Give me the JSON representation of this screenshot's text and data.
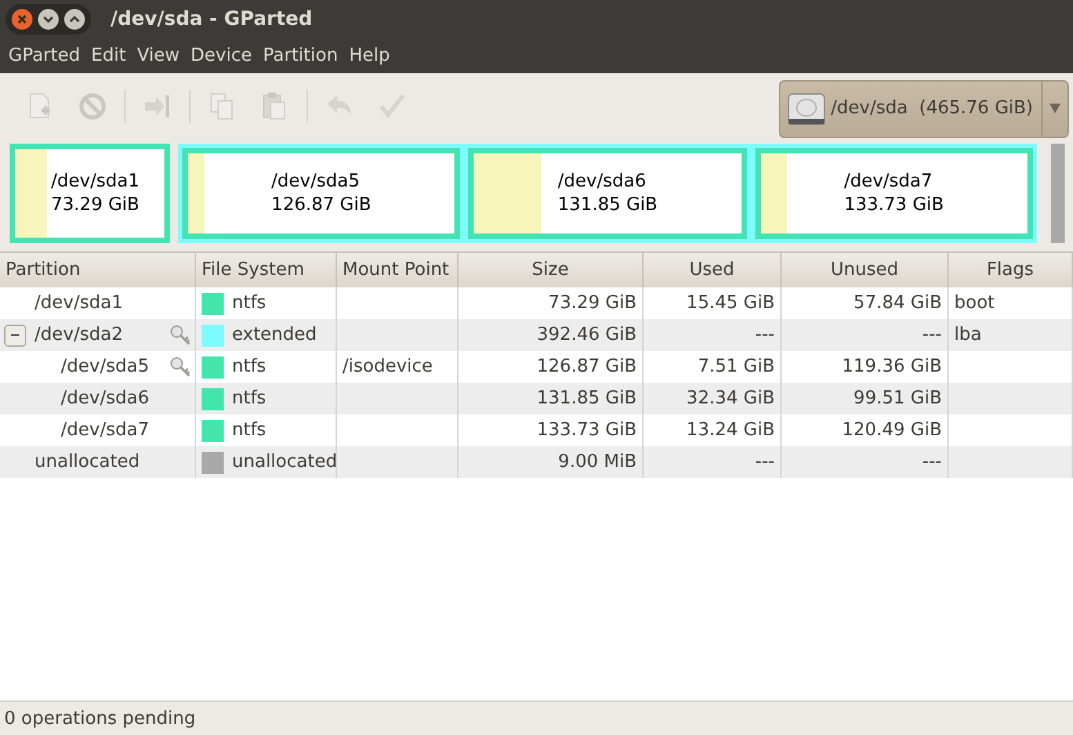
{
  "window": {
    "title": "/dev/sda - GParted",
    "controls": [
      {
        "kind": "close"
      },
      {
        "kind": "minimize"
      },
      {
        "kind": "maximize"
      }
    ]
  },
  "menu": [
    "GParted",
    "Edit",
    "View",
    "Device",
    "Partition",
    "Help"
  ],
  "toolbar": {
    "buttons": [
      {
        "kind": "new",
        "disabled": true
      },
      {
        "kind": "delete",
        "disabled": true
      },
      {
        "kind": "resize",
        "disabled": true
      },
      {
        "kind": "copy",
        "disabled": true
      },
      {
        "kind": "paste",
        "disabled": true
      },
      {
        "kind": "undo",
        "disabled": true
      },
      {
        "kind": "apply",
        "disabled": true
      }
    ],
    "device": {
      "label": "/dev/sda  (465.76 GiB)"
    }
  },
  "disk_map": {
    "blocks": [
      {
        "kind": "primary",
        "name": "/dev/sda1",
        "size": "73.29 GiB",
        "level": 0.21
      },
      {
        "kind": "extended",
        "children": [
          {
            "name": "/dev/sda5",
            "size": "126.87 GiB",
            "level": 0.06
          },
          {
            "name": "/dev/sda6",
            "size": "131.85 GiB",
            "level": 0.25
          },
          {
            "name": "/dev/sda7",
            "size": "133.73 GiB",
            "level": 0.1
          }
        ]
      },
      {
        "kind": "unallocated"
      }
    ]
  },
  "table": {
    "columns": [
      "Partition",
      "File System",
      "Mount Point",
      "Size",
      "Used",
      "Unused",
      "Flags"
    ],
    "rows": [
      {
        "partition": "/dev/sda1",
        "busy": false,
        "filesystem": "ntfs",
        "color": "#42e5ac",
        "size": "73.29 GiB",
        "used": "15.45 GiB",
        "unused": "57.84 GiB",
        "flags": "boot"
      },
      {
        "partition": "/dev/sda2",
        "busy": true,
        "expanded": true,
        "filesystem": "extended",
        "color": "#7dfcfe",
        "size": "392.46 GiB",
        "used": "---",
        "unused": "---",
        "flags": "lba",
        "children": [
          {
            "partition": "/dev/sda5",
            "busy": true,
            "filesystem": "ntfs",
            "color": "#42e5ac",
            "mount": "/isodevice",
            "size": "126.87 GiB",
            "used": "7.51 GiB",
            "unused": "119.36 GiB"
          },
          {
            "partition": "/dev/sda6",
            "busy": false,
            "filesystem": "ntfs",
            "color": "#42e5ac",
            "size": "131.85 GiB",
            "used": "32.34 GiB",
            "unused": "99.51 GiB"
          },
          {
            "partition": "/dev/sda7",
            "busy": false,
            "filesystem": "ntfs",
            "color": "#42e5ac",
            "size": "133.73 GiB",
            "used": "13.24 GiB",
            "unused": "120.49 GiB"
          }
        ]
      },
      {
        "partition": "unallocated",
        "busy": false,
        "filesystem": "unallocated",
        "color": "#a9a9a9",
        "size": "9.00 MiB",
        "used": "---",
        "unused": "---"
      }
    ]
  },
  "status_bar": {
    "text": "0 operations pending"
  }
}
